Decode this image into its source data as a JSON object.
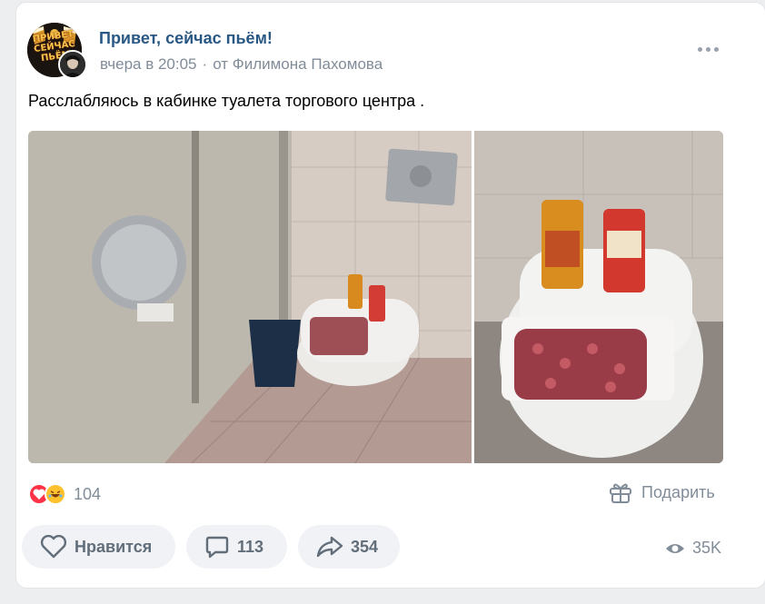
{
  "post": {
    "group_name": "Привет, сейчас пьём!",
    "avatar_text": "ПРИВЕТ СЕЙЧАС ПЬЁМ",
    "time": "вчера в 20:05",
    "separator": "·",
    "author": "от Филимона Пахомова",
    "text": "Расслабляюсь в кабинке туалета торгового центра .",
    "photos": [
      {
        "name": "toilet-stall-photo",
        "description_icon": "photo"
      },
      {
        "name": "toilet-closeup-photo",
        "description_icon": "photo"
      }
    ]
  },
  "reactions": {
    "count": "104",
    "icons": [
      "heart-icon",
      "laugh-icon"
    ]
  },
  "gift": {
    "label": "Подарить"
  },
  "actions": {
    "like_label": "Нравится",
    "comments_count": "113",
    "shares_count": "354"
  },
  "views": {
    "count": "35K"
  },
  "colors": {
    "link": "#2a5885",
    "secondary": "#818c99",
    "button_bg": "#f0f2f5",
    "heart": "#ff3347"
  }
}
